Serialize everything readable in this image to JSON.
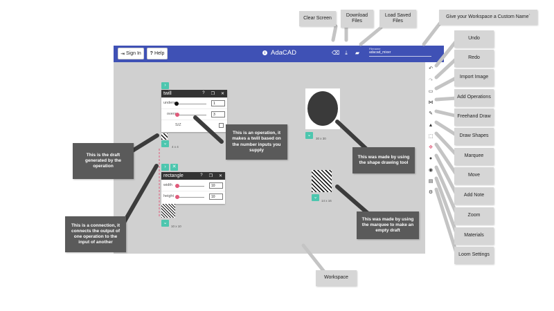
{
  "header": {
    "sign_in_label": "Sign In",
    "help_label": "Help",
    "app_title": "AdaCAD",
    "filename_label": "Filename",
    "filename_value": "adacad_mixer"
  },
  "operations": [
    {
      "name": "twill",
      "params": [
        {
          "label": "unders",
          "value": "1"
        },
        {
          "label": "overs",
          "value": "3"
        },
        {
          "label": "S/Z",
          "value": ""
        }
      ],
      "draft_size": "4 x 4"
    },
    {
      "name": "rectangle",
      "params": [
        {
          "label": "width",
          "value": "10"
        },
        {
          "label": "height",
          "value": "10"
        }
      ],
      "draft_size": "10 x 10"
    }
  ],
  "drafts": {
    "circle_size": "30 x 30",
    "marquee_size": "14 x 16"
  },
  "annotations": {
    "operation": "This is an operation, it makes a twill based on the number inputs you supply",
    "draft": "This is the draft generated by the operation",
    "connection": "This is a connection, it connects the output of one operation to the input of another",
    "shape_tool": "This was made by using the shape drawing tool",
    "marquee_draft": "This was made by using the marquee to  make an empty draft"
  },
  "tool_labels": {
    "clear_screen": "Clear Screen",
    "download_files": "Download Files",
    "load_saved_files": "Load Saved Files",
    "custom_name": "Give your Workspace a Custom Name`",
    "undo": "Undo",
    "redo": "Redo",
    "import_image": "Import Image",
    "add_operations": "Add Operations",
    "freehand_draw": "Freehand Draw",
    "draw_shapes": "Draw Shapes",
    "marquee": "Marquee",
    "move": "Move",
    "add_note": "Add Note",
    "zoom": "Zoom",
    "materials": "Materials",
    "loom_settings": "Loom Settings",
    "workspace": "Workspace"
  },
  "colors": {
    "header_blue": "#3f51b5",
    "workspace_gray": "#d0d0d0",
    "teal": "#4dc6ae",
    "callout_dark": "#5a5a5a",
    "label_gray": "#d6d6d6"
  }
}
